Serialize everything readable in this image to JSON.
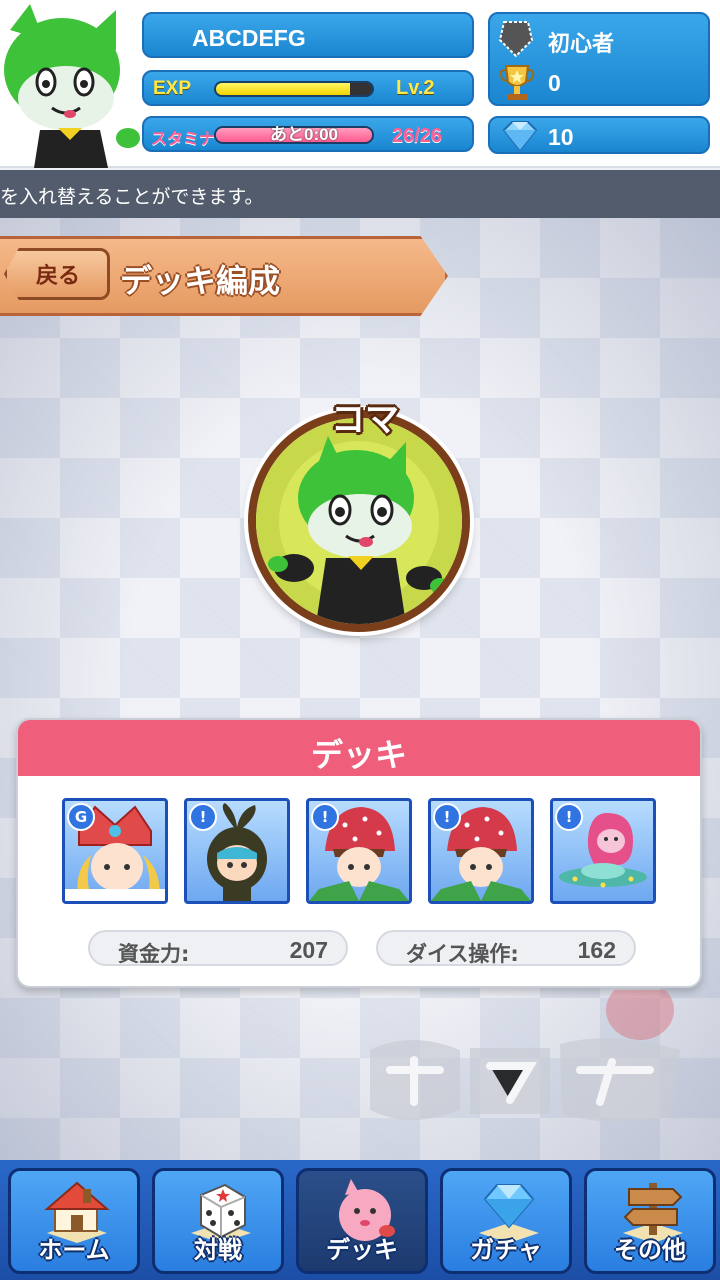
{
  "header": {
    "player_name": "ABCDEFG",
    "exp_label": "EXP",
    "exp_progress": 0.86,
    "level": "Lv.2",
    "stamina_label": "スタミナ",
    "stamina_timer": "あと0:00",
    "stamina_progress": 1.0,
    "stamina_count": "26/26",
    "rank": "初心者",
    "trophies": "0",
    "gems": "10"
  },
  "ticker": {
    "text": "を入れ替えることができます。"
  },
  "title_bar": {
    "back_label": "戻る",
    "title": "デッキ編成"
  },
  "character": {
    "label": "コマ"
  },
  "deck": {
    "title": "デッキ",
    "cards": [
      {
        "badge": "G",
        "name": "queen"
      },
      {
        "badge": "!",
        "name": "sprout"
      },
      {
        "badge": "!",
        "name": "strawberry-girl"
      },
      {
        "badge": "!",
        "name": "strawberry-girl"
      },
      {
        "badge": "!",
        "name": "ufo-ghost"
      }
    ],
    "stats": [
      {
        "label": "資金力:",
        "value": "207"
      },
      {
        "label": "ダイス操作:",
        "value": "162"
      }
    ]
  },
  "nav": {
    "items": [
      {
        "label": "ホーム",
        "icon": "house-icon"
      },
      {
        "label": "対戦",
        "icon": "dice-icon"
      },
      {
        "label": "デッキ",
        "icon": "monster-icon"
      },
      {
        "label": "ガチャ",
        "icon": "crystal-icon"
      },
      {
        "label": "その他",
        "icon": "signpost-icon"
      }
    ],
    "active": "デッキ"
  },
  "colors": {
    "header_blue": "#2b95dd",
    "deck_header": "#ef5e7a",
    "title_bar": "#e59a62",
    "nav_blue": "#2a7ee0"
  }
}
